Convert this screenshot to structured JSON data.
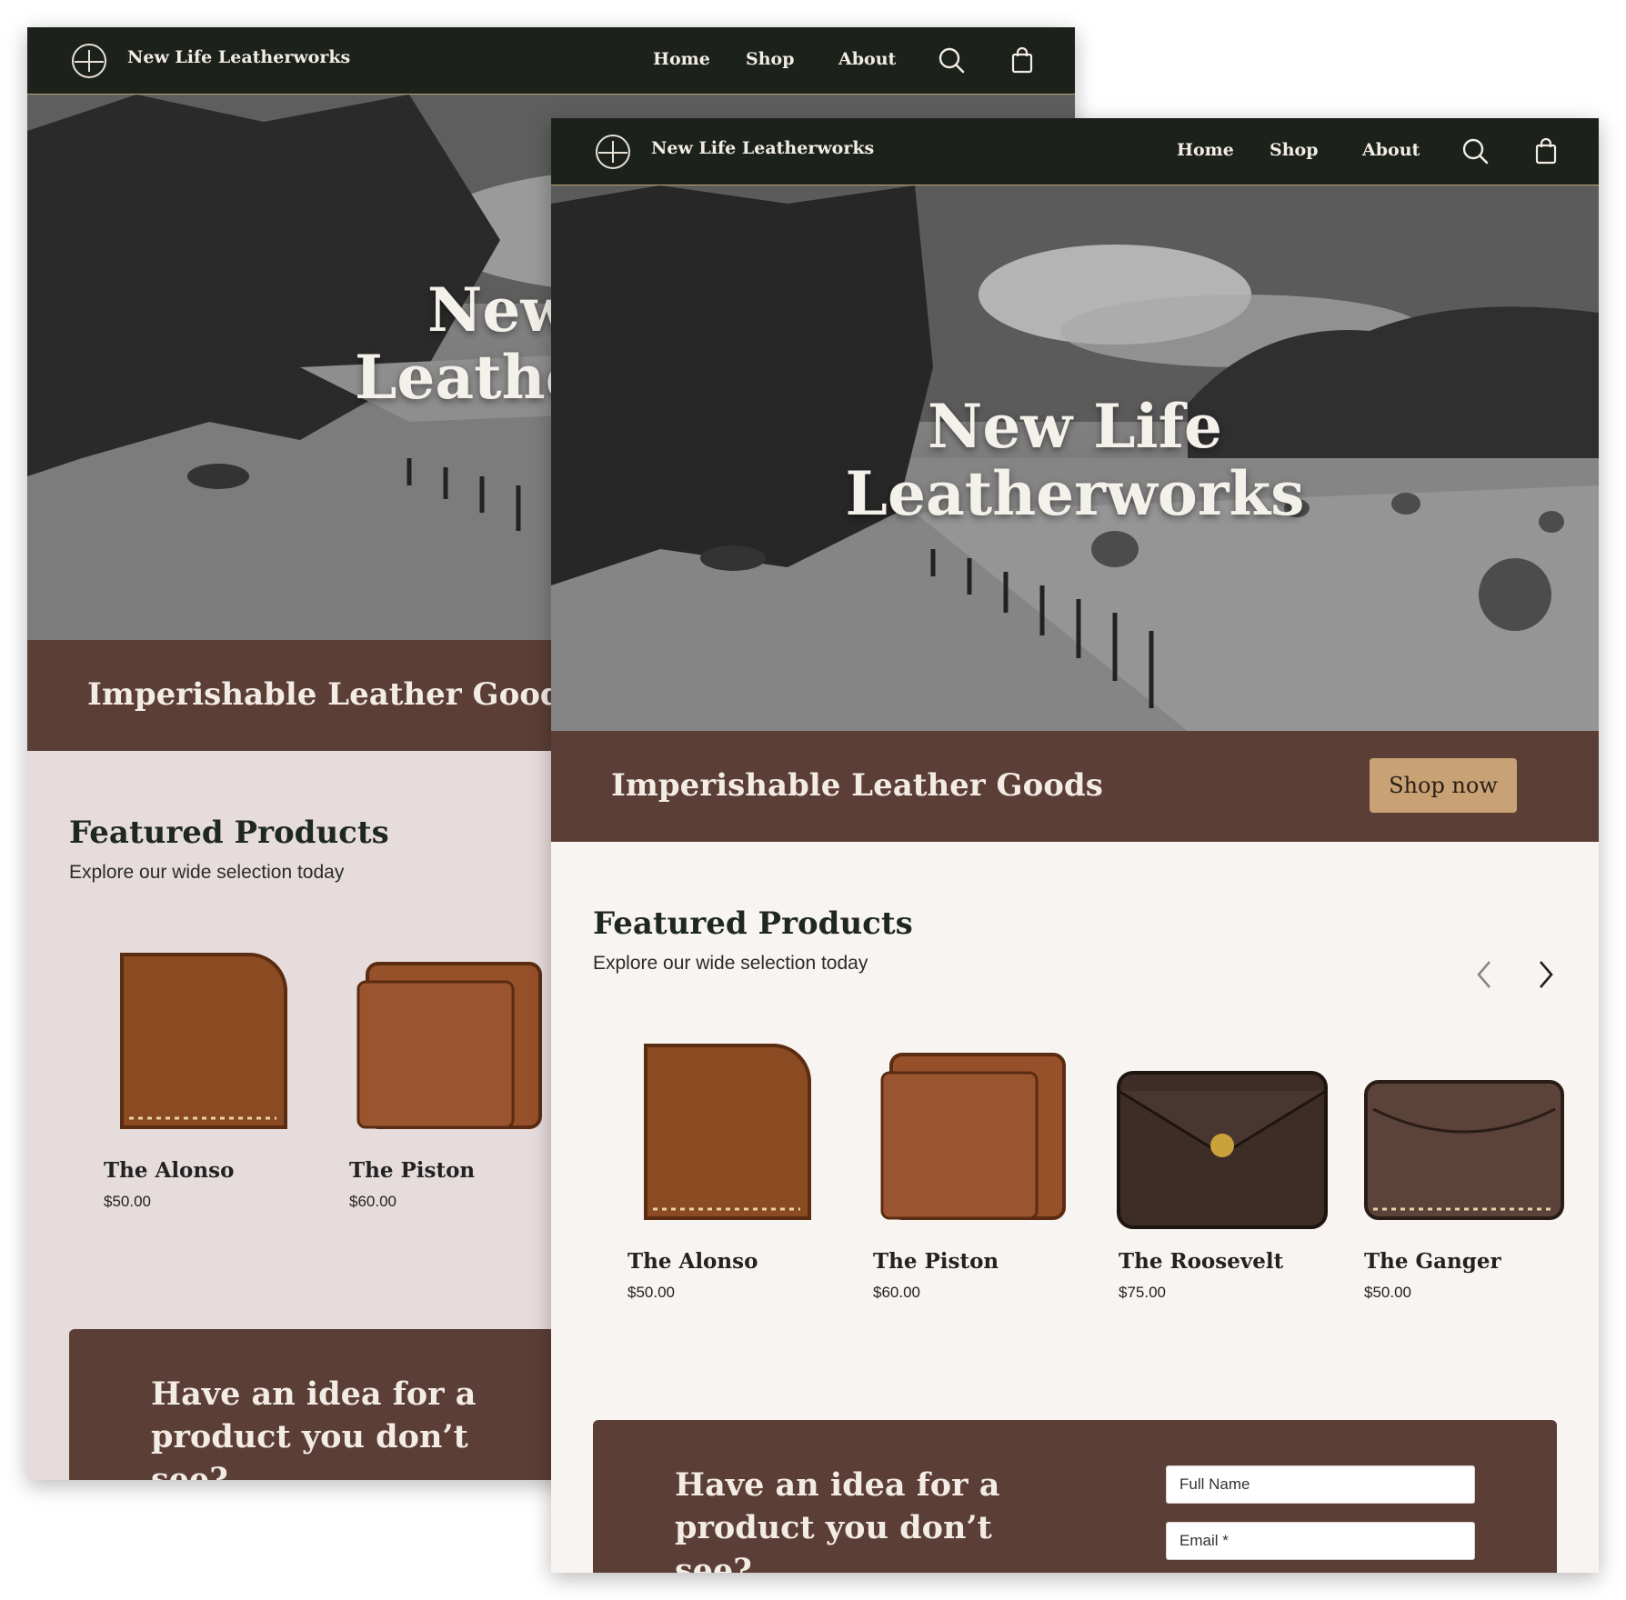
{
  "site": {
    "brand": "New Life Leatherworks",
    "nav": [
      "Home",
      "Shop",
      "About"
    ],
    "icons": [
      "search-icon",
      "shopping-bag-icon"
    ]
  },
  "hero": {
    "title_line1": "New Life",
    "title_line2": "Leatherworks",
    "back_title_line1": "New",
    "back_title_line2": "Leathe"
  },
  "band": {
    "tagline": "Imperishable Leather Goods",
    "button": "Shop now"
  },
  "featured": {
    "title": "Featured Products",
    "subtitle": "Explore our wide selection today",
    "arrows": [
      "chevron-left-icon",
      "chevron-right-icon"
    ],
    "products": [
      {
        "name": "The Alonso",
        "price": "$50.00"
      },
      {
        "name": "The Piston",
        "price": "$60.00"
      },
      {
        "name": "The Roosevelt",
        "price": "$75.00"
      },
      {
        "name": "The Ganger",
        "price": "$50.00"
      }
    ]
  },
  "cta": {
    "line1": "Have an idea for a",
    "line2": "product you don’t see?",
    "fullname_placeholder": "Full Name",
    "email_placeholder": "Email *"
  },
  "colors": {
    "nav": "#1d211c",
    "brown": "#5b3e35",
    "accent": "#c8a274",
    "back_bg": "#e6dcdc",
    "front_bg": "#f8f4f1"
  }
}
